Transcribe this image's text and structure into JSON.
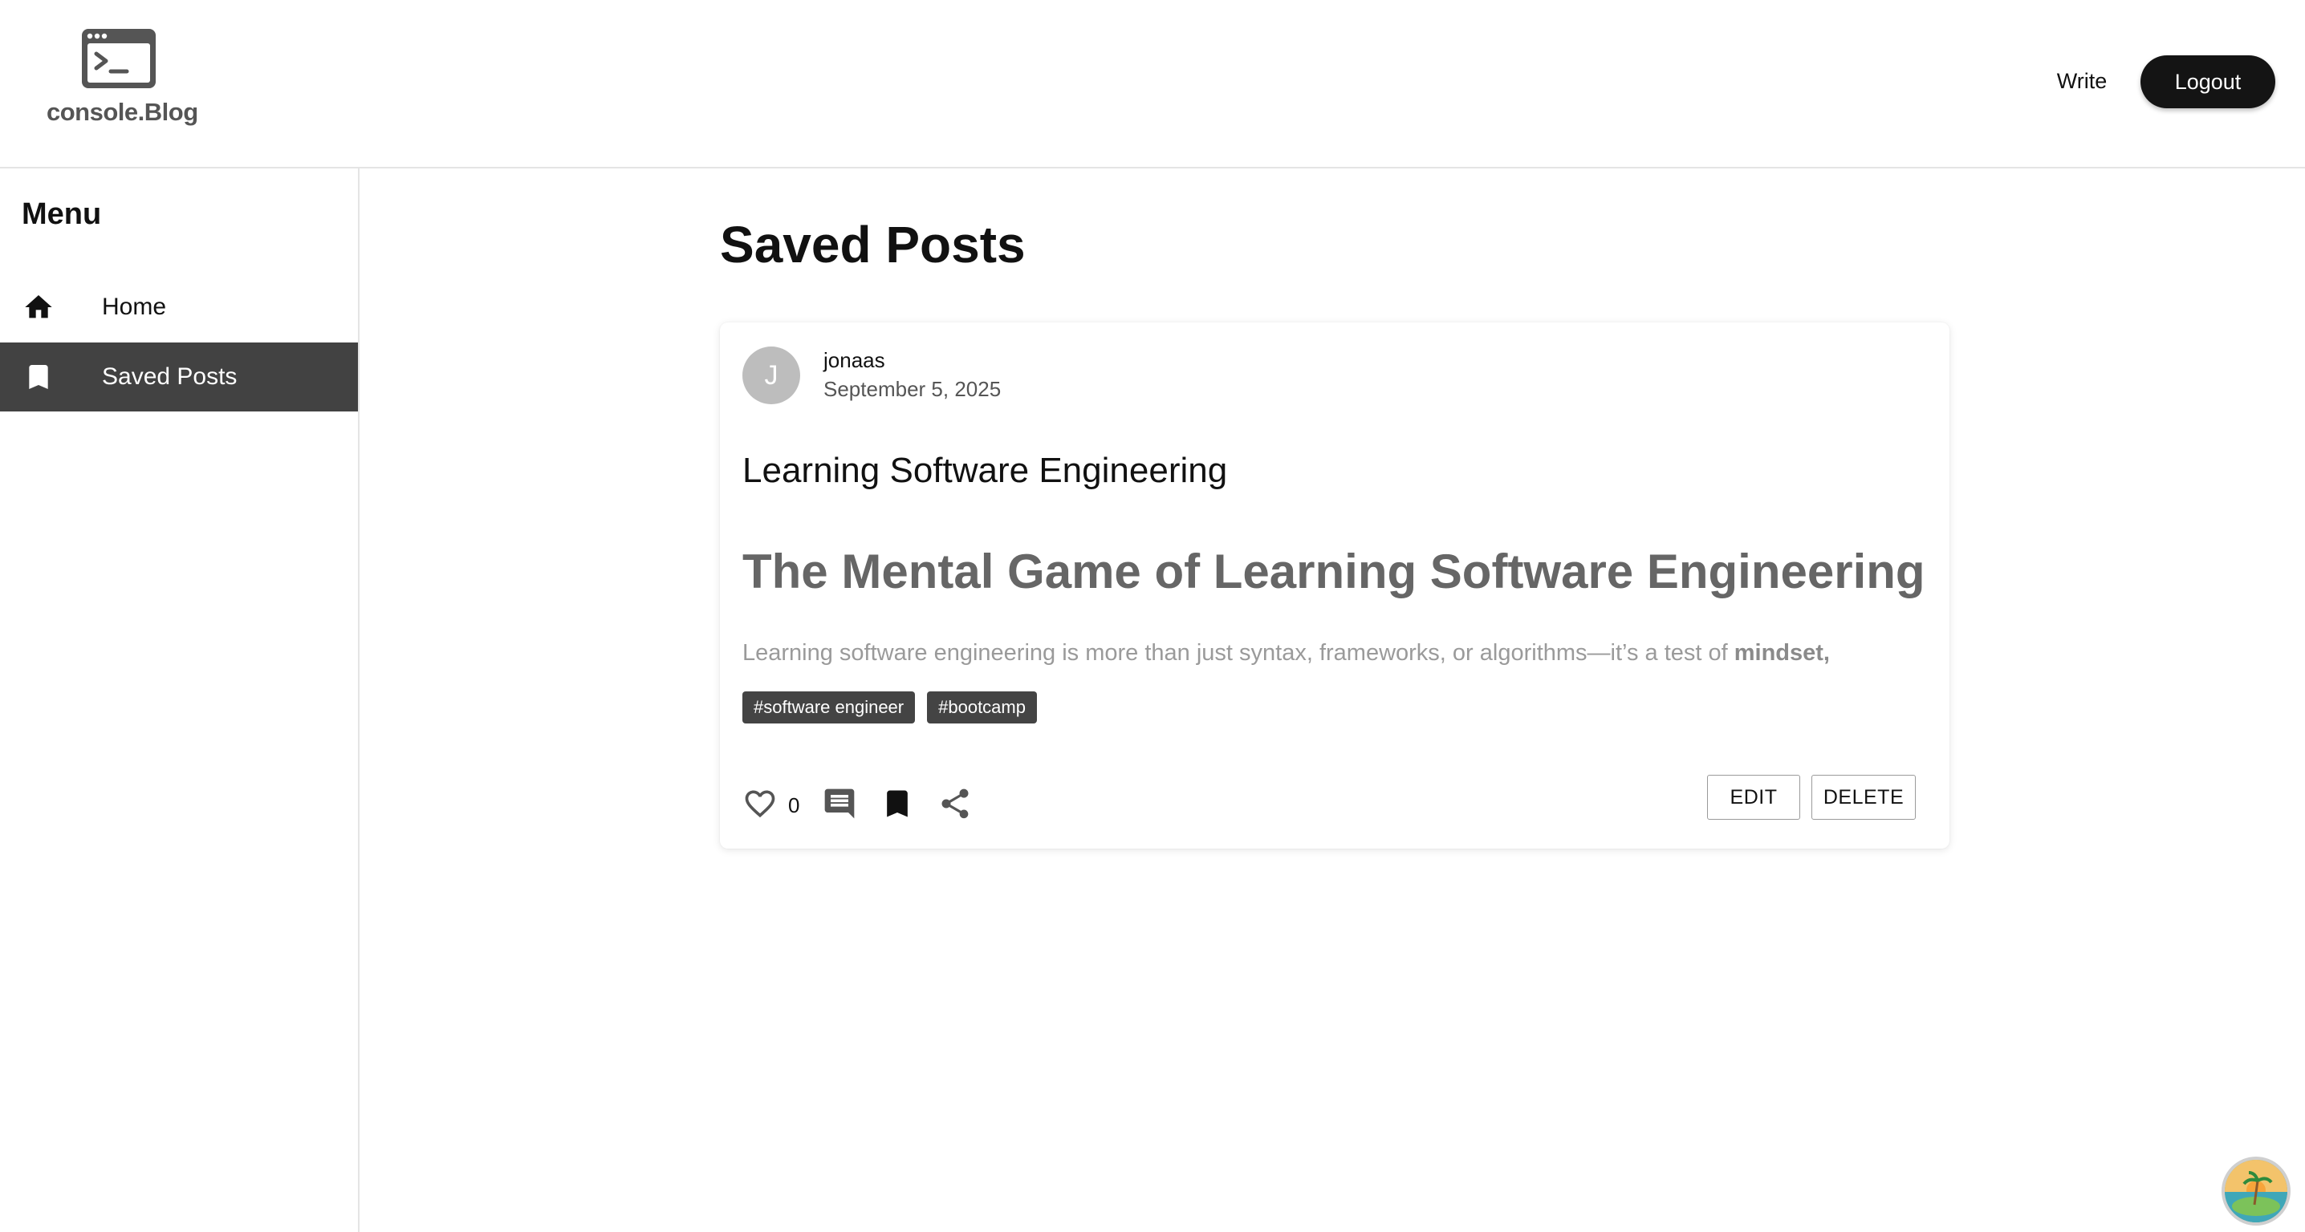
{
  "header": {
    "logo_text": "console.Blog",
    "write_label": "Write",
    "logout_label": "Logout"
  },
  "sidebar": {
    "title": "Menu",
    "items": [
      {
        "label": "Home",
        "icon": "home-icon",
        "active": false
      },
      {
        "label": "Saved Posts",
        "icon": "bookmark-icon",
        "active": true
      }
    ]
  },
  "main": {
    "page_title": "Saved Posts",
    "post": {
      "avatar_letter": "J",
      "author": "jonaas",
      "date": "September 5, 2025",
      "title": "Learning Software Engineering",
      "heading": "The Mental Game of Learning Software Engineering",
      "excerpt": "Learning software engineering is more than just syntax, frameworks, or algorithms—it’s a test of ",
      "excerpt_bold": "mindset,",
      "tags": [
        "#software engineer",
        "#bootcamp"
      ],
      "like_count": "0",
      "edit_label": "EDIT",
      "delete_label": "DELETE"
    }
  },
  "colors": {
    "active_nav_bg": "#424242",
    "button_dark": "#141414",
    "tag_bg": "#444444",
    "avatar_bg": "#bdbdbd"
  }
}
